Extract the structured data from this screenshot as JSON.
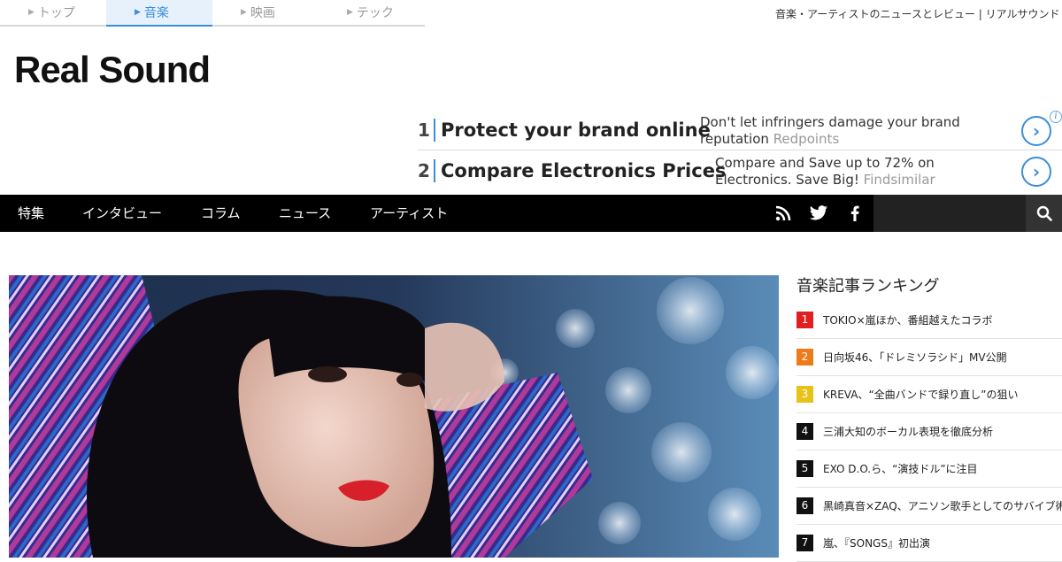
{
  "site_tabs": [
    {
      "label": "トップ",
      "active": false
    },
    {
      "label": "音楽",
      "active": true
    },
    {
      "label": "映画",
      "active": false
    },
    {
      "label": "テック",
      "active": false
    }
  ],
  "tagline": "音楽・アーティストのニュースとレビュー | リアルサウンド",
  "logo": "Real Sound",
  "ads": [
    {
      "num": "1",
      "title": "Protect your brand online",
      "desc": "Don't let infringers damage your brand reputation",
      "source": "Redpoints"
    },
    {
      "num": "2",
      "title": "Compare Electronics Prices",
      "desc": "Compare and Save up to 72% on Electronics. Save Big!",
      "source": "Findsimilar"
    }
  ],
  "nav": [
    "特集",
    "インタビュー",
    "コラム",
    "ニュース",
    "アーティスト"
  ],
  "nav_icons": [
    "rss-icon",
    "twitter-icon",
    "facebook-icon"
  ],
  "search": {
    "placeholder": ""
  },
  "ranking": {
    "title": "音楽記事ランキング",
    "items": [
      {
        "rank": "1",
        "text": "TOKIO×嵐ほか、番組越えたコラボ",
        "color": "#e0201e"
      },
      {
        "rank": "2",
        "text": "日向坂46、「ドレミソラシド」MV公開",
        "color": "#ee7a1a"
      },
      {
        "rank": "3",
        "text": "KREVA、“全曲バンドで録り直し”の狙い",
        "color": "#e8c218"
      },
      {
        "rank": "4",
        "text": "三浦大知のボーカル表現を徹底分析",
        "color": "#111111"
      },
      {
        "rank": "5",
        "text": "EXO D.O.ら、“演技ドル”に注目",
        "color": "#111111"
      },
      {
        "rank": "6",
        "text": "黒崎真音×ZAQ、アニソン歌手としてのサバイブ術",
        "color": "#111111"
      },
      {
        "rank": "7",
        "text": "嵐、『SONGS』初出演",
        "color": "#111111"
      }
    ]
  },
  "colors": {
    "accent": "#3a8ed8",
    "nav_bg": "#000000"
  }
}
